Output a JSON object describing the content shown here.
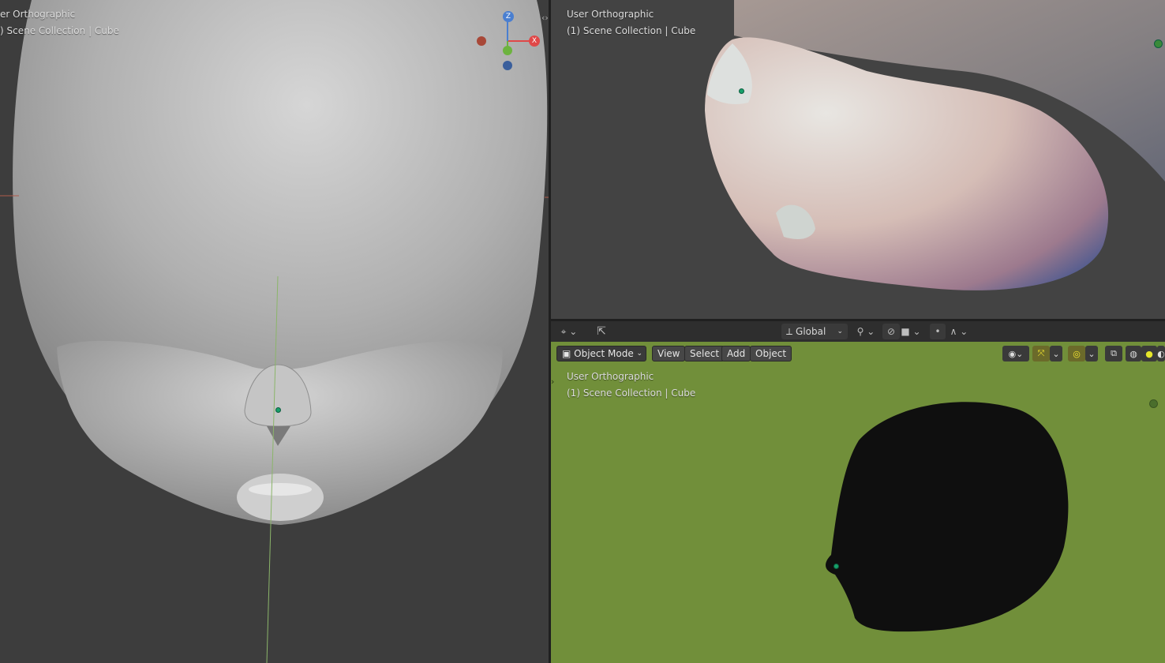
{
  "viewports": {
    "left": {
      "view_name": "er Orthographic",
      "collection": ") Scene Collection | Cube"
    },
    "right_top": {
      "view_name": "User Orthographic",
      "collection": "(1) Scene Collection | Cube"
    },
    "right_bottom": {
      "view_name": "User Orthographic",
      "collection": "(1) Scene Collection | Cube"
    }
  },
  "gizmo": {
    "z_label": "Z",
    "x_label": "X"
  },
  "header": {
    "orientation": "Global"
  },
  "menu": {
    "mode": "Object Mode",
    "view": "View",
    "select": "Select",
    "add": "Add",
    "object": "Object"
  },
  "colors": {
    "viewport_bg": "#3d3d3d",
    "green_bg": "#718f3a",
    "origin_dot": "#16a06a",
    "x_axis": "#e04848",
    "y_axis": "#6db33f",
    "z_axis": "#4a7fd0"
  },
  "icons": {
    "cursor": "cursor-move-icon",
    "eye": "eye-icon",
    "transform": "transform-pivot-icon",
    "snap": "snap-icon",
    "proportional": "proportional-edit-icon"
  }
}
